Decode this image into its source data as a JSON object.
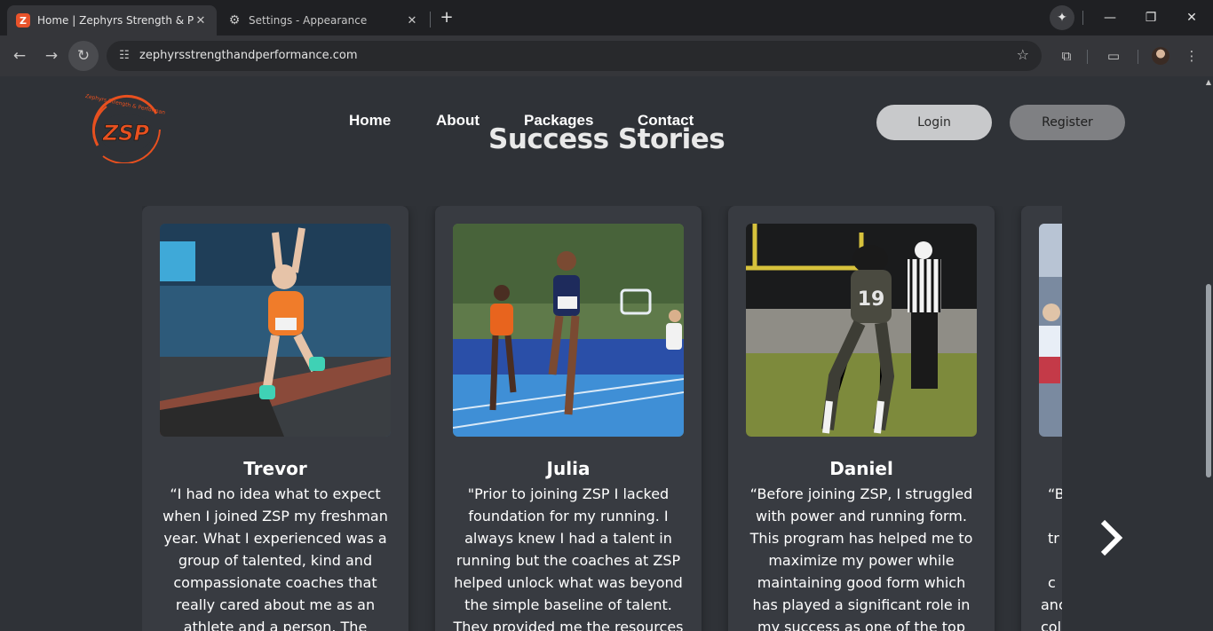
{
  "browser": {
    "tabs": [
      {
        "title": "Home | Zephyrs Strength & Performance",
        "favicon": "Z",
        "active": true
      },
      {
        "title": "Settings - Appearance",
        "icon": "gear-icon",
        "active": false
      }
    ],
    "url": "zephyrsstrengthandperformance.com"
  },
  "site": {
    "logo_text": "ZSP",
    "logo_arc_text": "Zephyrs Strength & Performance",
    "nav": [
      "Home",
      "About",
      "Packages",
      "Contact"
    ],
    "login_label": "Login",
    "register_label": "Register",
    "heading": "Success Stories",
    "colors": {
      "accent": "#e8501f",
      "background": "#2f3237",
      "card": "#383b41"
    }
  },
  "stories": [
    {
      "name": "Trevor",
      "quote": "“I had no idea what to expect when I joined ZSP my freshman year. What I experienced was a group of talented, kind and compassionate coaches that really cared about me as an athlete and a person. The"
    },
    {
      "name": "Julia",
      "quote": "\"Prior to joining ZSP I lacked foundation for my running. I always knew I had a talent in running but the coaches at ZSP helped unlock what was beyond the simple baseline of talent. They provided me the resources"
    },
    {
      "name": "Daniel",
      "quote": "“Before joining ZSP, I struggled with power and running form. This program has helped me to maximize my power while maintaining good form which has played a significant role in my success as one of the top"
    },
    {
      "name": "",
      "quote": "“B tr c anc col"
    }
  ]
}
